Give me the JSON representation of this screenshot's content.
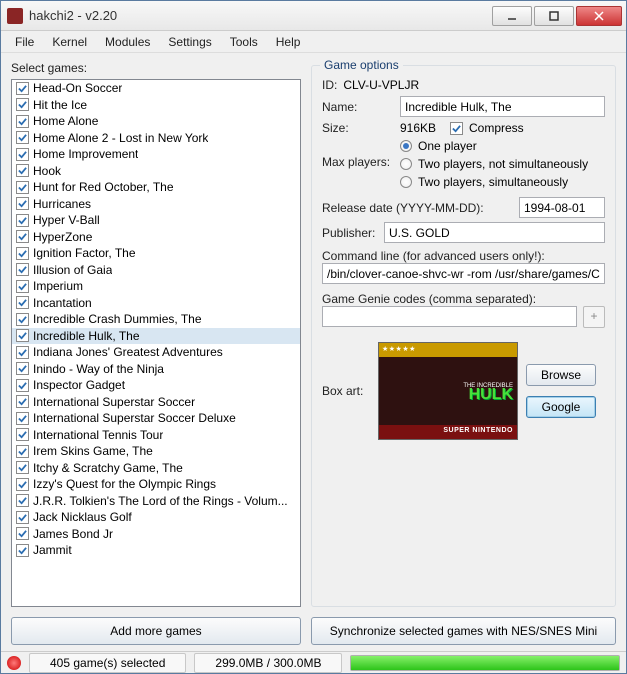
{
  "window": {
    "title": "hakchi2 - v2.20"
  },
  "menu": {
    "file": "File",
    "kernel": "Kernel",
    "modules": "Modules",
    "settings": "Settings",
    "tools": "Tools",
    "help": "Help"
  },
  "left": {
    "label": "Select games:",
    "games": [
      "Head-On Soccer",
      "Hit the Ice",
      "Home Alone",
      "Home Alone 2 - Lost in New York",
      "Home Improvement",
      "Hook",
      "Hunt for Red October, The",
      "Hurricanes",
      "Hyper V-Ball",
      "HyperZone",
      "Ignition Factor, The",
      "Illusion of Gaia",
      "Imperium",
      "Incantation",
      "Incredible Crash Dummies, The",
      "Incredible Hulk, The",
      "Indiana Jones' Greatest Adventures",
      "Inindo - Way of the Ninja",
      "Inspector Gadget",
      "International Superstar Soccer",
      "International Superstar Soccer Deluxe",
      "International Tennis Tour",
      "Irem Skins Game, The",
      "Itchy & Scratchy Game, The",
      "Izzy's Quest for the Olympic Rings",
      "J.R.R. Tolkien's The Lord of the Rings - Volum...",
      "Jack Nicklaus Golf",
      "James Bond Jr",
      "Jammit"
    ],
    "selected_index": 15,
    "add_button": "Add more games"
  },
  "options": {
    "legend": "Game options",
    "id_label": "ID:",
    "id_value": "CLV-U-VPLJR",
    "name_label": "Name:",
    "name_value": "Incredible Hulk, The",
    "size_label": "Size:",
    "size_value": "916KB",
    "compress_label": "Compress",
    "maxplayers_label": "Max players:",
    "mp_one": "One player",
    "mp_two_ns": "Two players, not simultaneously",
    "mp_two_s": "Two players, simultaneously",
    "release_label": "Release date (YYYY-MM-DD):",
    "release_value": "1994-08-01",
    "publisher_label": "Publisher:",
    "publisher_value": "U.S. GOLD",
    "cmdline_label": "Command line (for advanced users only!):",
    "cmdline_value": "/bin/clover-canoe-shvc-wr -rom /usr/share/games/C",
    "gg_label": "Game Genie codes (comma separated):",
    "gg_value": "",
    "boxart_label": "Box art:",
    "boxart_sub1": "THE INCREDIBLE",
    "boxart_title": "HULK",
    "boxart_bottom": "SUPER NINTENDO",
    "browse": "Browse",
    "google": "Google",
    "plus": "+"
  },
  "sync_button": "Synchronize selected games with NES/SNES Mini",
  "status": {
    "selected": "405 game(s) selected",
    "size": "299.0MB / 300.0MB"
  }
}
